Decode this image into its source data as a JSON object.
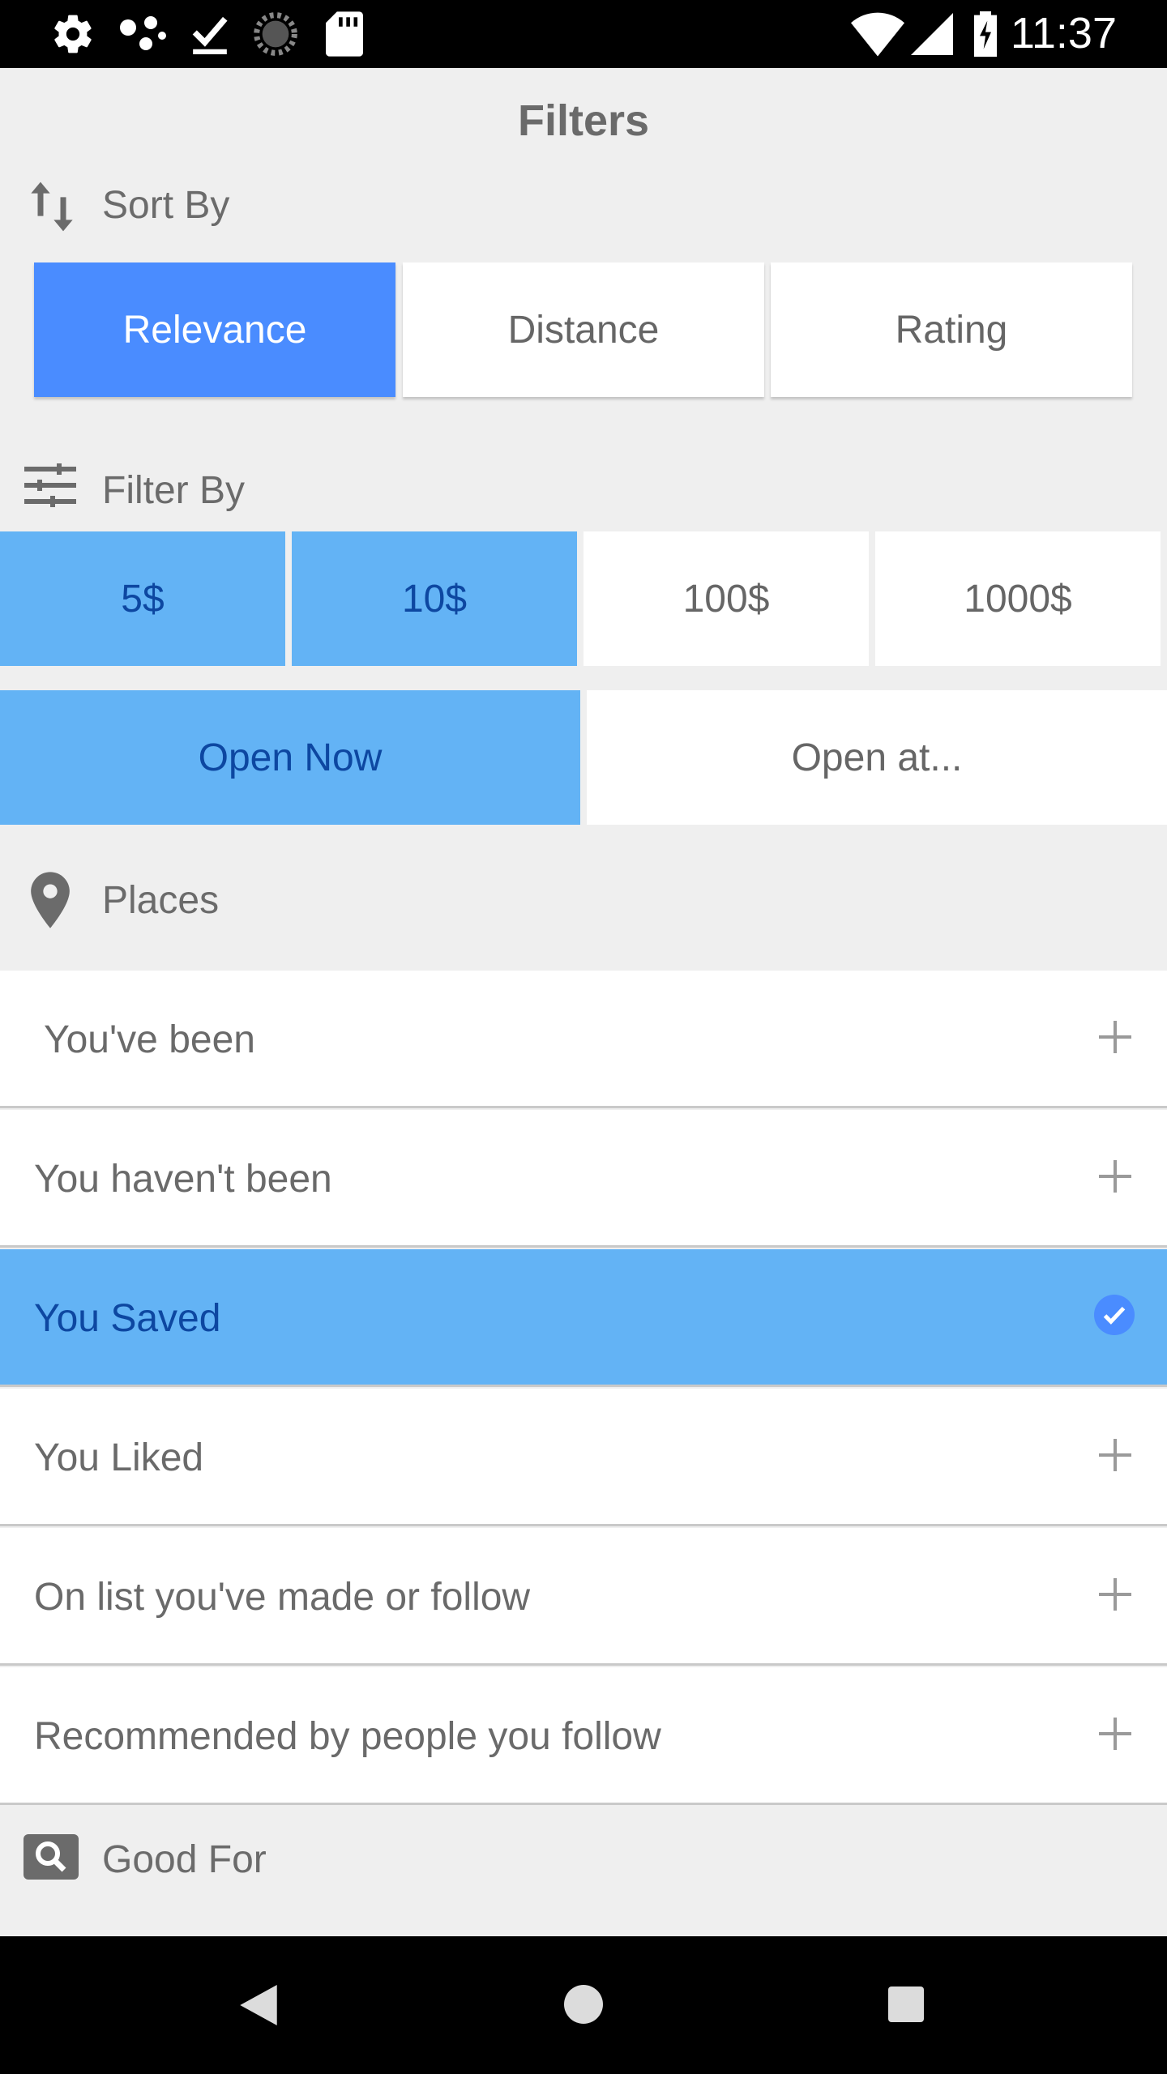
{
  "status_bar": {
    "time": "11:37",
    "left_icons": [
      "settings-icon",
      "nearby-icon",
      "download-done-icon",
      "loading-icon",
      "sd-card-icon"
    ],
    "right_icons": [
      "wifi-icon",
      "signal-icon",
      "battery-charging-icon"
    ]
  },
  "page": {
    "title": "Filters"
  },
  "sort": {
    "label": "Sort By",
    "icon": "sort-arrows-icon",
    "options": [
      "Relevance",
      "Distance",
      "Rating"
    ],
    "selected": "Relevance"
  },
  "filter": {
    "label": "Filter By",
    "icon": "sliders-icon",
    "prices": [
      "5$",
      "10$",
      "100$",
      "1000$"
    ],
    "selected_prices": [
      "5$",
      "10$"
    ],
    "open_options": [
      "Open Now",
      "Open at..."
    ],
    "selected_open": "Open Now"
  },
  "places": {
    "label": "Places",
    "icon": "location-pin-icon",
    "items": [
      {
        "label": "You've been",
        "selected": false
      },
      {
        "label": "You haven't been",
        "selected": false
      },
      {
        "label": "You Saved",
        "selected": true
      },
      {
        "label": "You Liked",
        "selected": false
      },
      {
        "label": "On list you've made or follow",
        "selected": false
      },
      {
        "label": "Recommended by people you follow",
        "selected": false
      }
    ]
  },
  "good_for": {
    "label": "Good For",
    "icon": "search-box-icon"
  },
  "colors": {
    "primary_selected": "#4a8cff",
    "light_selected": "#63b3f5",
    "selected_text": "#0d47a1",
    "background": "#efefef"
  },
  "nav": {
    "icons": [
      "back-icon",
      "home-icon",
      "recents-icon"
    ]
  }
}
